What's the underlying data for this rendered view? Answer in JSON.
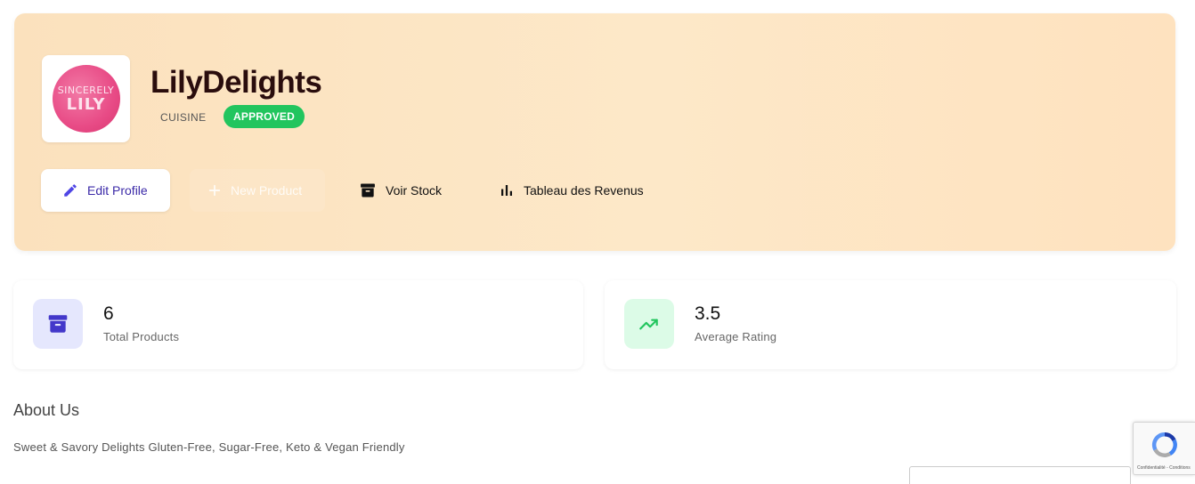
{
  "shop": {
    "name": "LilyDelights",
    "category": "CUISINE",
    "status": "APPROVED",
    "logo": {
      "line1": "SINCERELY",
      "line2": "LILY",
      "icon": "shop-logo"
    }
  },
  "actions": {
    "edit_profile": "Edit Profile",
    "new_product": "New Product",
    "voir_stock": "Voir Stock",
    "tableau_revenus": "Tableau des Revenus"
  },
  "stats": {
    "products": {
      "value": "6",
      "label": "Total Products",
      "icon": "archive-box-icon"
    },
    "rating": {
      "value": "3.5",
      "label": "Average Rating",
      "icon": "trending-up-icon"
    }
  },
  "about": {
    "title": "About Us",
    "text": "Sweet & Savory Delights Gluten-Free, Sugar-Free, Keto & Vegan Friendly"
  },
  "recaptcha": {
    "text": "Confidentialité - Conditions"
  },
  "colors": {
    "hero_bg": "#fde5c4",
    "approved": "#22c55e",
    "accent_purple": "#4f46e5",
    "accent_green": "#22c55e"
  }
}
